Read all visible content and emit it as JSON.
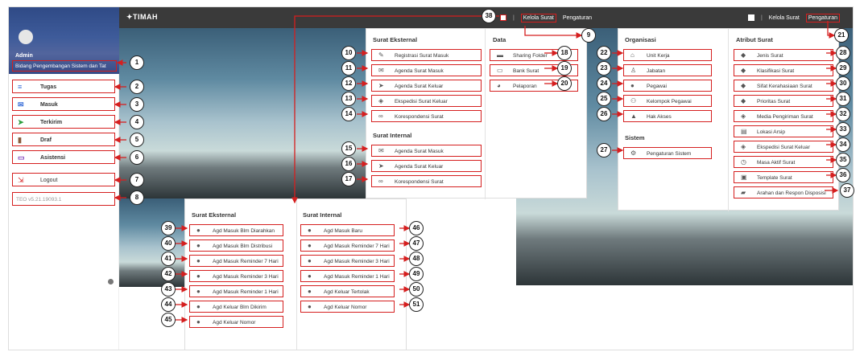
{
  "topbar": {
    "logo": "TIMAH",
    "kelola": "Kelola Surat",
    "pengaturan": "Pengaturan",
    "kelola_right": "Kelola Surat",
    "pengaturan_right": "Pengaturan",
    "sep": "|"
  },
  "sidebar": {
    "admin": "Admin",
    "unit": "Bidang Pengembangan Sistem dan Tat",
    "items": [
      {
        "label": "Tugas",
        "icon": "list-icon"
      },
      {
        "label": "Masuk",
        "icon": "envelope-icon"
      },
      {
        "label": "Terkirim",
        "icon": "send-icon"
      },
      {
        "label": "Draf",
        "icon": "draft-icon"
      },
      {
        "label": "Asistensi",
        "icon": "monitor-icon"
      }
    ],
    "logout": "Logout",
    "version": "TEO v5.21.19093.1"
  },
  "surat_eksternal": {
    "title": "Surat Eksternal",
    "items": [
      "Registrasi Surat Masuk",
      "Agenda Surat Masuk",
      "Agenda Surat Keluar",
      "Ekspedisi Surat Keluar",
      "Korespondensi Surat"
    ]
  },
  "surat_internal": {
    "title": "Surat Internal",
    "items": [
      "Agenda Surat Masuk",
      "Agenda Surat Keluar",
      "Korespondensi Surat"
    ]
  },
  "data_menu": {
    "title": "Data",
    "items": [
      "Sharing Folder",
      "Bank Surat",
      "Pelaporan"
    ]
  },
  "organisasi": {
    "title": "Organisasi",
    "items": [
      "Unit Kerja",
      "Jabatan",
      "Pegawai",
      "Kelompok Pegawai",
      "Hak Akses"
    ]
  },
  "sistem": {
    "title": "Sistem",
    "items": [
      "Pengaturan Sistem"
    ]
  },
  "atribut": {
    "title": "Atribut Surat",
    "items": [
      "Jenis Surat",
      "Klasifikasi Surat",
      "Sifat Kerahasiaan Surat",
      "Prioritas Surat",
      "Media Pengiriman Surat",
      "Lokasi Arsip",
      "Ekspedisi Surat Keluar",
      "Masa Aktif Surat",
      "Template Surat",
      "Arahan dan Respon Disposisi"
    ]
  },
  "reminder_eksternal": {
    "title": "Surat Eksternal",
    "items": [
      "Agd Masuk Blm Diarahkan",
      "Agd Masuk Blm Distribusi",
      "Agd Masuk Reminder 7 Hari",
      "Agd Masuk Reminder 3 Hari",
      "Agd Masuk Reminder 1 Hari",
      "Agd Keluar Blm Dikirim",
      "Agd Keluar Nomor"
    ]
  },
  "reminder_internal": {
    "title": "Surat Internal",
    "items": [
      "Agd Masuk Baru",
      "Agd Masuk Reminder 7 Hari",
      "Agd Masuk Reminder 3 Hari",
      "Agd Masuk Reminder 1 Hari",
      "Agd Keluar Tertolak",
      "Agd Keluar Nomor"
    ]
  },
  "callouts": [
    "1",
    "2",
    "3",
    "4",
    "5",
    "6",
    "7",
    "8",
    "9",
    "10",
    "11",
    "12",
    "13",
    "14",
    "15",
    "16",
    "17",
    "18",
    "19",
    "20",
    "21",
    "22",
    "23",
    "24",
    "25",
    "26",
    "27",
    "28",
    "29",
    "30",
    "31",
    "32",
    "33",
    "34",
    "35",
    "36",
    "37",
    "38",
    "39",
    "40",
    "41",
    "42",
    "43",
    "44",
    "45",
    "46",
    "47",
    "48",
    "49",
    "50",
    "51"
  ],
  "colors": {
    "topbar": "#3a3a3a",
    "highlight": "#d51f1f",
    "profile": "#3e5b9a"
  }
}
